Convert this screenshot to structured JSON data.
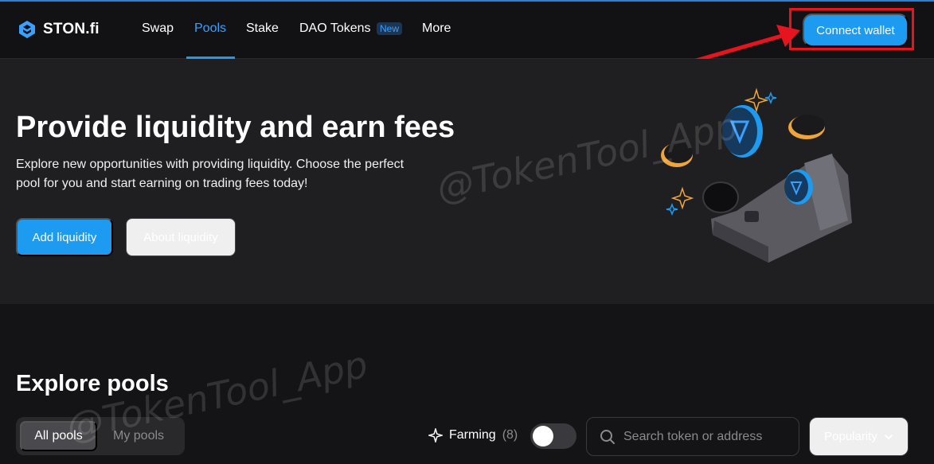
{
  "brand": {
    "name": "STON.fi"
  },
  "nav": {
    "items": [
      {
        "label": "Swap"
      },
      {
        "label": "Pools"
      },
      {
        "label": "Stake"
      },
      {
        "label": "DAO Tokens"
      },
      {
        "label": "More"
      }
    ],
    "active": "Pools",
    "new_badge": "New",
    "connect_wallet": "Connect wallet"
  },
  "hero": {
    "title": "Provide liquidity and earn fees",
    "subtitle": "Explore new opportunities with providing liquidity. Choose the perfect pool for you and start earning on trading fees today!",
    "primary_button": "Add liquidity",
    "secondary_button": "About liquidity"
  },
  "watermark": "@TokenTool_App",
  "pools": {
    "title": "Explore pools",
    "tabs": [
      {
        "label": "All pools"
      },
      {
        "label": "My pools"
      }
    ],
    "farming_label": "Farming",
    "farming_count": "(8)",
    "farming_enabled": false,
    "search_placeholder": "Search token or address",
    "sort_label": "Popularity"
  },
  "colors": {
    "accent": "#1d9bf0",
    "background": "#141416",
    "hero_background": "#1f1f21",
    "annotation_red": "#e6141e"
  }
}
